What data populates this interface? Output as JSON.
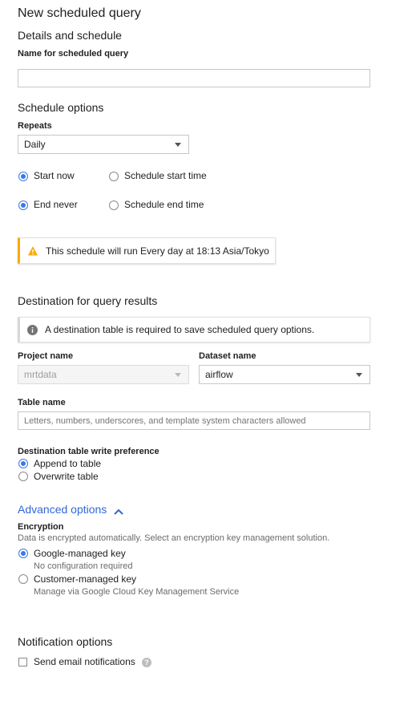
{
  "page": {
    "title": "New scheduled query"
  },
  "details": {
    "heading": "Details and schedule",
    "name_label": "Name for scheduled query",
    "name_value": ""
  },
  "schedule": {
    "heading": "Schedule options",
    "repeats_label": "Repeats",
    "repeats_value": "Daily",
    "start_now": "Start now",
    "schedule_start_time": "Schedule start time",
    "end_never": "End never",
    "schedule_end_time": "Schedule end time",
    "start_selected": "Start now",
    "end_selected": "End never",
    "warning": "This schedule will run Every day at 18:13 Asia/Tokyo"
  },
  "destination": {
    "heading": "Destination for query results",
    "info": "A destination table is required to save scheduled query options.",
    "project_label": "Project name",
    "project_value": "mrtdata",
    "dataset_label": "Dataset name",
    "dataset_value": "airflow",
    "table_label": "Table name",
    "table_placeholder": "Letters, numbers, underscores, and template system characters allowed",
    "write_pref_label": "Destination table write preference",
    "append": "Append to table",
    "overwrite": "Overwrite table",
    "write_pref_selected": "Append to table"
  },
  "advanced": {
    "toggle_label": "Advanced options",
    "encryption_label": "Encryption",
    "encryption_desc": "Data is encrypted automatically. Select an encryption key management solution.",
    "google_key": "Google-managed key",
    "google_key_desc": "No configuration required",
    "customer_key": "Customer-managed key",
    "customer_key_desc": "Manage via Google Cloud Key Management Service",
    "selected": "Google-managed key"
  },
  "notifications": {
    "heading": "Notification options",
    "email_label": "Send email notifications",
    "email_checked": false
  },
  "colors": {
    "accent": "#3b78e7",
    "link": "#3367d6",
    "warning": "#f9ab00"
  },
  "icons": [
    "warning-icon",
    "info-icon",
    "chevron-up-icon",
    "help-icon",
    "dropdown-caret-icon"
  ]
}
